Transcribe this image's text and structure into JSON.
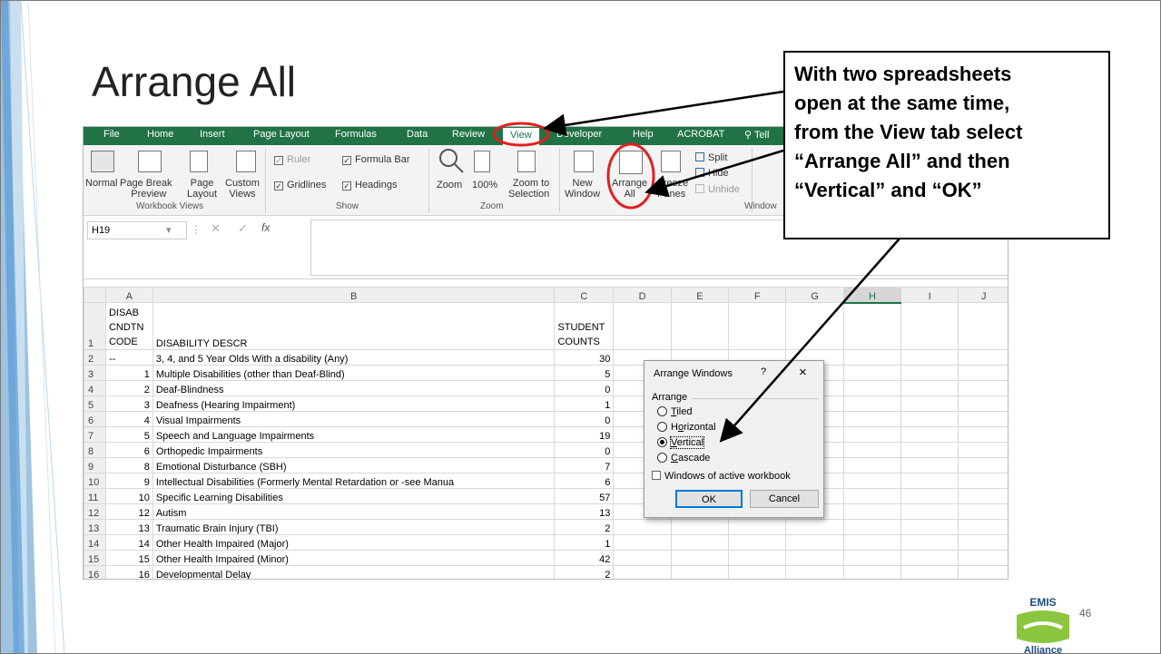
{
  "slide": {
    "title": "Arrange All",
    "page_number": "46",
    "callout_lines": [
      "With two spreadsheets",
      "open at the same time,",
      "from the View tab select",
      "“Arrange All” and then",
      "“Vertical” and “OK”"
    ],
    "logo": {
      "top_text": "EMIS",
      "bottom_text": "Alliance"
    }
  },
  "excel": {
    "colors": {
      "accent": "#217346",
      "highlight": "#e02020"
    },
    "tabs": [
      "File",
      "Home",
      "Insert",
      "Page Layout",
      "Formulas",
      "Data",
      "Review",
      "View",
      "Developer",
      "Help",
      "ACROBAT",
      "Tell"
    ],
    "ribbon": {
      "workbook_views": {
        "normal": "Normal",
        "page_break": [
          "Page Break",
          "Preview"
        ],
        "page_layout": [
          "Page",
          "Layout"
        ],
        "custom": [
          "Custom",
          "Views"
        ],
        "group": "Workbook Views"
      },
      "show": {
        "ruler": "Ruler",
        "formula_bar": "Formula Bar",
        "gridlines": "Gridlines",
        "headings": "Headings",
        "group": "Show"
      },
      "zoom": {
        "zoom": "Zoom",
        "hundred": "100%",
        "zoom_to": [
          "Zoom to",
          "Selection"
        ],
        "group": "Zoom"
      },
      "window": {
        "new": [
          "New",
          "Window"
        ],
        "arrange": [
          "Arrange",
          "All"
        ],
        "freeze": [
          "Freeze",
          "Panes"
        ],
        "split": "Split",
        "hide": "Hide",
        "unhide": "Unhide",
        "group": "Window"
      }
    },
    "name_box": "H19",
    "fx": "fx",
    "columns": [
      "A",
      "B",
      "C",
      "D",
      "E",
      "F",
      "G",
      "H",
      "I",
      "J"
    ],
    "header_row": {
      "a": [
        "DISAB",
        "CNDTN",
        "CODE"
      ],
      "b": "DISABILITY DESCR",
      "c": [
        "STUDENT",
        "COUNTS"
      ]
    },
    "rows": [
      {
        "n": "2",
        "code": "--",
        "desc": "3, 4, and 5 Year Olds With a disability (Any)",
        "count": "30"
      },
      {
        "n": "3",
        "code": "1",
        "desc": "Multiple Disabilities (other than Deaf-Blind)",
        "count": "5"
      },
      {
        "n": "4",
        "code": "2",
        "desc": "Deaf-Blindness",
        "count": "0"
      },
      {
        "n": "5",
        "code": "3",
        "desc": "Deafness (Hearing Impairment)",
        "count": "1"
      },
      {
        "n": "6",
        "code": "4",
        "desc": "Visual Impairments",
        "count": "0"
      },
      {
        "n": "7",
        "code": "5",
        "desc": "Speech and Language Impairments",
        "count": "19"
      },
      {
        "n": "8",
        "code": "6",
        "desc": "Orthopedic Impairments",
        "count": "0"
      },
      {
        "n": "9",
        "code": "8",
        "desc": "Emotional Disturbance (SBH)",
        "count": "7"
      },
      {
        "n": "10",
        "code": "9",
        "desc": "Intellectual Disabilities (Formerly Mental Retardation or -see Manua",
        "count": "6"
      },
      {
        "n": "11",
        "code": "10",
        "desc": "Specific Learning Disabilities",
        "count": "57"
      },
      {
        "n": "12",
        "code": "12",
        "desc": "Autism",
        "count": "13"
      },
      {
        "n": "13",
        "code": "13",
        "desc": "Traumatic Brain Injury (TBI)",
        "count": "2"
      },
      {
        "n": "14",
        "code": "14",
        "desc": "Other Health Impaired (Major)",
        "count": "1"
      },
      {
        "n": "15",
        "code": "15",
        "desc": "Other Health Impaired (Minor)",
        "count": "42"
      },
      {
        "n": "16",
        "code": "16",
        "desc": "Developmental Delay",
        "count": "2"
      }
    ]
  },
  "dialog": {
    "title": "Arrange Windows",
    "help": "?",
    "close": "×",
    "group_label": "Arrange",
    "options": [
      {
        "label": "Tiled",
        "key": "T",
        "rest": "iled",
        "selected": false
      },
      {
        "label": "Horizontal",
        "key": "o",
        "rest": "rizontal",
        "selected": false
      },
      {
        "label": "Vertical",
        "key": "V",
        "rest": "ertical",
        "selected": true
      },
      {
        "label": "Cascade",
        "key": "C",
        "rest": "ascade",
        "selected": false
      }
    ],
    "checkbox": {
      "label": "Windows of active workbook",
      "checked": false
    },
    "ok": "OK",
    "cancel": "Cancel"
  }
}
